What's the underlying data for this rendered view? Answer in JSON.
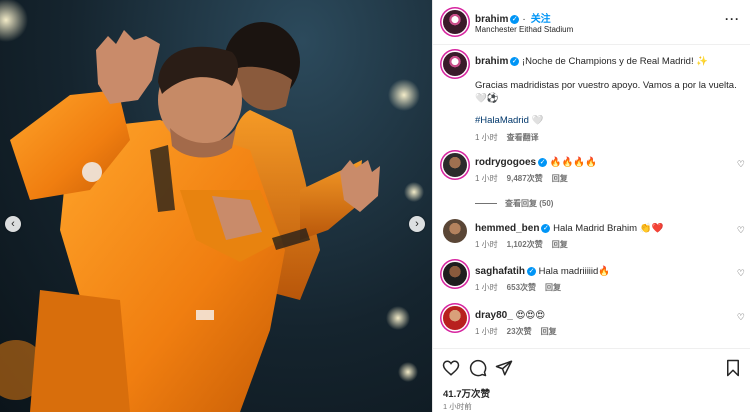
{
  "author": {
    "username": "brahim",
    "follow_label": "关注",
    "location": "Manchester Eithad Stadium"
  },
  "caption": {
    "text": "¡Noche de Champions y de Real Madrid! ✨",
    "line2": "Gracias madridistas por vuestro apoyo. Vamos a por la vuelta. 🤍⚽",
    "hashtag": "#HalaMadrid 🤍",
    "time": "1 小时",
    "translate": "查看翻译"
  },
  "comments": [
    {
      "username": "rodrygogoes",
      "verified": true,
      "text": "🔥🔥🔥🔥",
      "time": "1 小时",
      "likes": "9,487次赞",
      "reply": "回复"
    },
    {
      "username": "hemmed_ben",
      "verified": true,
      "text": "Hala Madrid Brahim 👏❤️",
      "time": "1 小时",
      "likes": "1,102次赞",
      "reply": "回复"
    },
    {
      "username": "saghafatih",
      "verified": true,
      "text": "Hala madriiiiid🔥",
      "time": "1 小时",
      "likes": "653次赞",
      "reply": "回复"
    },
    {
      "username": "dray80_",
      "verified": false,
      "text": "😍😍😍",
      "time": "1 小时",
      "likes": "23次赞",
      "reply": "回复"
    }
  ],
  "view_replies": "查看回复 (50)",
  "likes_total": "41.7万次赞",
  "posted_ago": "1 小时前",
  "colors": {
    "accent": "#0095f6",
    "hashtag": "#00376b",
    "muted": "#737373",
    "kit": "#f08a14"
  },
  "icons": [
    "chevron-left-icon",
    "chevron-right-icon",
    "verified-icon",
    "more-icon",
    "heart-icon",
    "comment-icon",
    "share-icon",
    "bookmark-icon"
  ]
}
